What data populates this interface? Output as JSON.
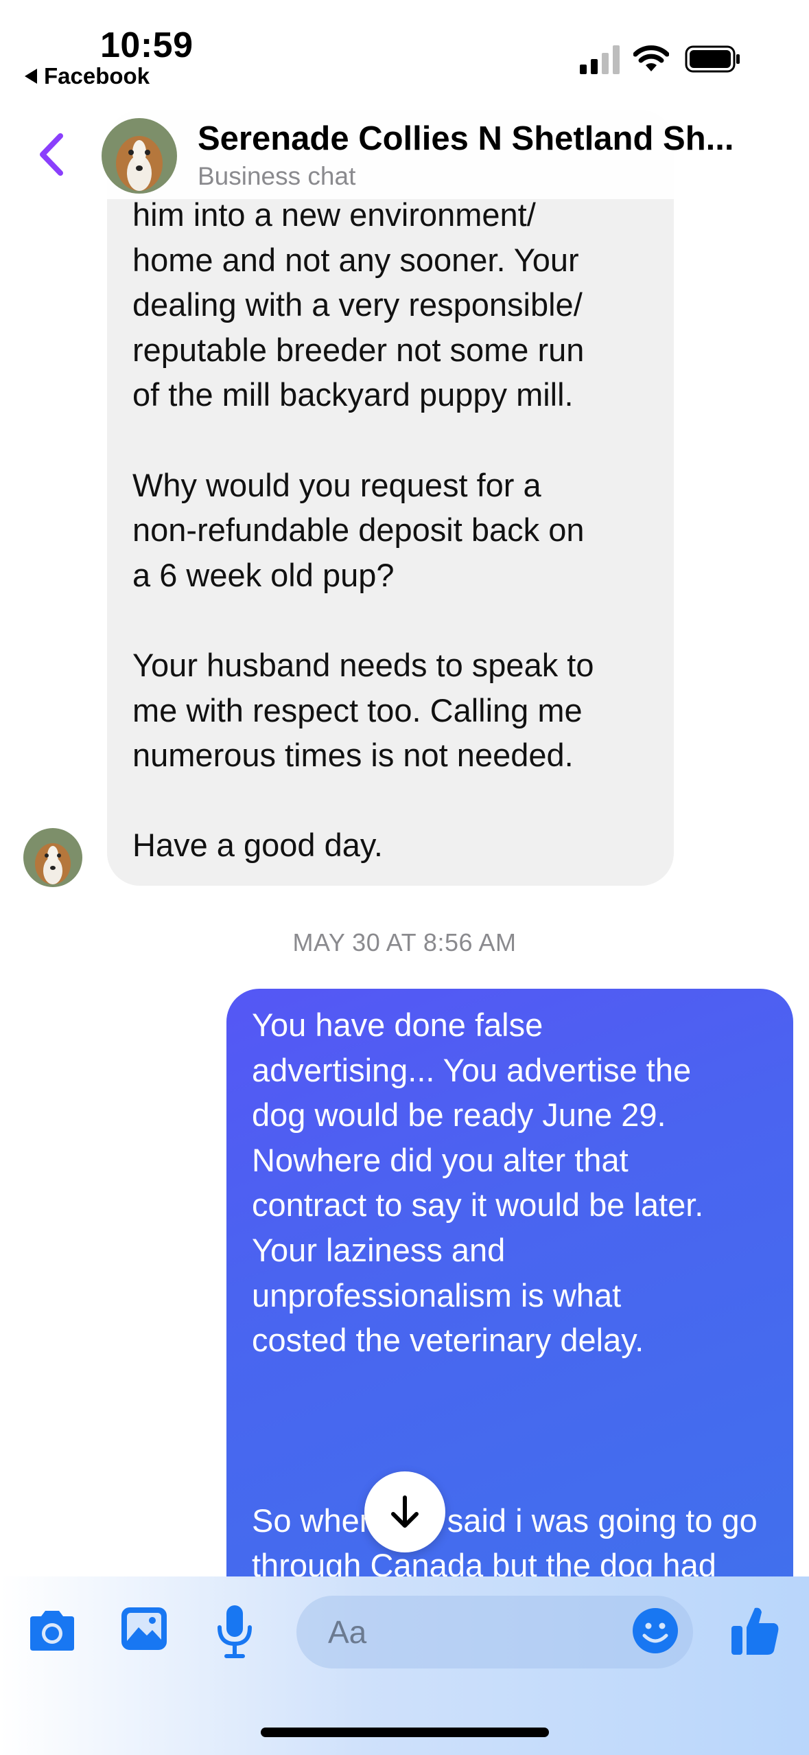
{
  "status_bar": {
    "time": "10:59",
    "back_app_label": "Facebook",
    "icons": [
      "signal-icon",
      "wifi-icon",
      "battery-icon"
    ]
  },
  "header": {
    "title": "Serenade Collies N Shetland Sh...",
    "subtitle": "Business chat",
    "back_icon": "chevron-left-icon",
    "accent_color": "#8a3ffc"
  },
  "messages": {
    "incoming": {
      "text": "him into a new environment/\nhome and not any sooner. Your\ndealing with a very responsible/\nreputable breeder not some run\nof the mill backyard puppy mill.\n\nWhy would you request for a\nnon-refundable deposit back on\na 6 week old pup?\n\nYour husband needs to speak to\nme with respect too. Calling me\nnumerous times is not needed.\n\nHave a good day.",
      "bubble_color": "#f0f0f0"
    },
    "timestamp": "MAY 30 AT 8:56 AM",
    "outgoing": {
      "text": "You have done false\nadvertising... You advertise the\ndog would be ready June 29.\nNowhere did you alter that\ncontract to say it would be later.\nYour laziness and\nunprofessionalism is what\ncosted the veterinary delay.\n\n\n\nSo when you said i was going to go\nthrough Canada but the dog had",
      "bubble_gradient": [
        "#5557f5",
        "#3f72ec"
      ]
    }
  },
  "scroll_button_icon": "arrow-down-icon",
  "composer": {
    "placeholder": "Aa",
    "icons": [
      "camera-icon",
      "gallery-icon",
      "microphone-icon",
      "emoji-icon",
      "thumbs-up-icon"
    ],
    "icon_color": "#1877f2"
  }
}
